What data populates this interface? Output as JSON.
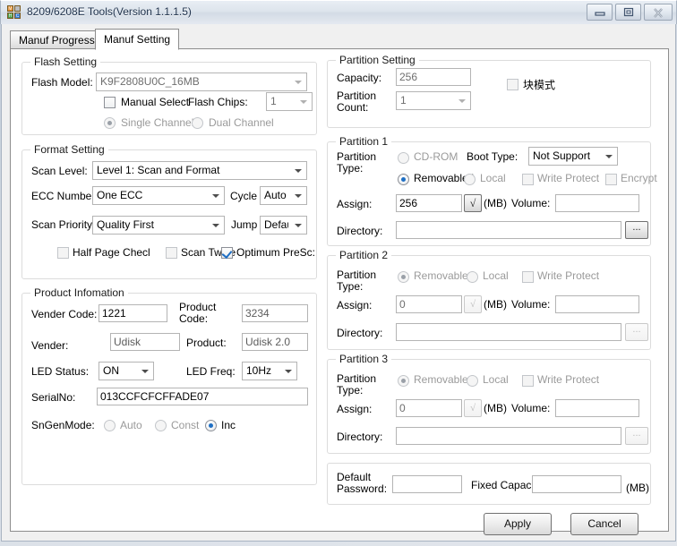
{
  "window": {
    "title": "8209/6208E Tools(Version 1.1.1.5)",
    "icon": "app-icon",
    "minimize_label": "minimize-icon",
    "maximize_label": "maximize-icon",
    "close_label": "close-icon"
  },
  "tabs": [
    {
      "label": "Manuf Progress",
      "active": false
    },
    {
      "label": "Manuf Setting",
      "active": true
    }
  ],
  "flash_setting": {
    "caption": "Flash Setting",
    "flash_model_label": "Flash Model:",
    "flash_model_value": "K9F2808U0C_16MB",
    "manual_select_label": "Manual Select",
    "manual_select_checked": false,
    "flash_chips_label": "Flash Chips:",
    "flash_chips_value": "1",
    "single_channel_label": "Single Channel",
    "single_channel_selected": true,
    "dual_channel_label": "Dual Channel",
    "dual_channel_selected": false
  },
  "format_setting": {
    "caption": "Format Setting",
    "scan_level_label": "Scan Level:",
    "scan_level_value": "Level 1: Scan and Format",
    "ecc_number_label": "ECC Number:",
    "ecc_number_value": "One ECC",
    "cycle_label": "Cycle",
    "cycle_value": "Auto Dete",
    "scan_priority_label": "Scan Priority:",
    "scan_priority_value": "Quality First",
    "jump_label": "Jump",
    "jump_value": "Default",
    "half_page_check_label": "Half Page Checl",
    "half_page_check_checked": false,
    "scan_twice_label": "Scan Twice",
    "scan_twice_checked": false,
    "optimum_prescan_label": "Optimum PreSc:",
    "optimum_prescan_checked": true
  },
  "product_information": {
    "caption": "Product Infomation",
    "vender_code_label": "Vender Code:",
    "vender_code_value": "1221",
    "product_code_label": "Product Code:",
    "product_code_value": "3234",
    "vender_label": "Vender:",
    "vender_value": "Udisk",
    "product_label": "Product:",
    "product_value": "Udisk 2.0",
    "led_status_label": "LED Status:",
    "led_status_value": "ON",
    "led_freq_label": "LED Freq:",
    "led_freq_value": "10Hz",
    "serialno_label": "SerialNo:",
    "serialno_value": "013CCFCFCFFADE07",
    "sngenmode_label": "SnGenMode:",
    "sngenmode_options": [
      {
        "label": "Auto",
        "selected": false
      },
      {
        "label": "Const",
        "selected": false
      },
      {
        "label": "Inc",
        "selected": true
      }
    ]
  },
  "partition_setting": {
    "caption": "Partition Setting",
    "capacity_label": "Capacity:",
    "capacity_value": "256",
    "partition_count_label": "Partition Count:",
    "partition_count_value": "1",
    "block_mode_label": "块模式",
    "block_mode_checked": false
  },
  "partition1": {
    "caption": "Partition 1",
    "partition_type_label": "Partition Type:",
    "cdrom_label": "CD-ROM",
    "cdrom_selected": false,
    "boot_type_label": "Boot Type:",
    "boot_type_value": "Not Support",
    "removable_label": "Removable I",
    "removable_selected": true,
    "local_label": "Local",
    "local_selected": false,
    "write_protect_label": "Write Protect",
    "write_protect_checked": false,
    "encrypt_label": "Encrypt",
    "encrypt_checked": false,
    "assign_label": "Assign:",
    "assign_value": "256",
    "sqrt_button_label": "√",
    "mb_label": "(MB)",
    "volume_label": "Volume:",
    "volume_value": "",
    "directory_label": "Directory:",
    "directory_value": "",
    "browse_label": "..."
  },
  "partition2": {
    "caption": "Partition 2",
    "partition_type_label": "Partition Type:",
    "removable_label": "Removable",
    "removable_selected": true,
    "local_label": "Local",
    "local_selected": false,
    "write_protect_label": "Write Protect",
    "write_protect_checked": false,
    "assign_label": "Assign:",
    "assign_value": "0",
    "sqrt_button_label": "√",
    "mb_label": "(MB)",
    "volume_label": "Volume:",
    "volume_value": "",
    "directory_label": "Directory:",
    "directory_value": "",
    "browse_label": "..."
  },
  "partition3": {
    "caption": "Partition 3",
    "partition_type_label": "Partition Type:",
    "removable_label": "Removable",
    "removable_selected": true,
    "local_label": "Local",
    "local_selected": false,
    "write_protect_label": "Write Protect",
    "write_protect_checked": false,
    "assign_label": "Assign:",
    "assign_value": "0",
    "sqrt_button_label": "√",
    "mb_label": "(MB)",
    "volume_label": "Volume:",
    "volume_value": "",
    "directory_label": "Directory:",
    "directory_value": "",
    "browse_label": "..."
  },
  "footer": {
    "default_password_label": "Default Password:",
    "default_password_value": "",
    "fixed_capacity_label": "Fixed Capacit",
    "fixed_capacity_value": "",
    "mb_label": "(MB)",
    "apply_label": "Apply",
    "cancel_label": "Cancel"
  },
  "colors": {
    "accent": "#1f6fc4",
    "window_bg": "#f0f0f0",
    "page_bg": "#ffffff",
    "group_border": "#dcdcdc",
    "disabled_text": "#9a9a9a"
  }
}
